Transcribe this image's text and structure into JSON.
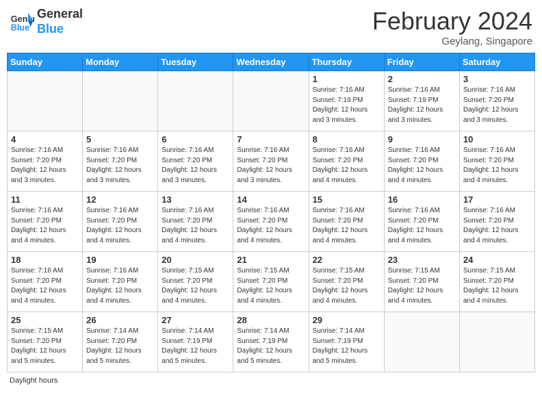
{
  "header": {
    "logo_general": "General",
    "logo_blue": "Blue",
    "month_year": "February 2024",
    "location": "Geylang, Singapore"
  },
  "days_of_week": [
    "Sunday",
    "Monday",
    "Tuesday",
    "Wednesday",
    "Thursday",
    "Friday",
    "Saturday"
  ],
  "weeks": [
    [
      {
        "day": "",
        "empty": true
      },
      {
        "day": "",
        "empty": true
      },
      {
        "day": "",
        "empty": true
      },
      {
        "day": "",
        "empty": true
      },
      {
        "day": "1",
        "sunrise": "7:16 AM",
        "sunset": "7:19 PM",
        "daylight": "12 hours and 3 minutes."
      },
      {
        "day": "2",
        "sunrise": "7:16 AM",
        "sunset": "7:19 PM",
        "daylight": "12 hours and 3 minutes."
      },
      {
        "day": "3",
        "sunrise": "7:16 AM",
        "sunset": "7:20 PM",
        "daylight": "12 hours and 3 minutes."
      }
    ],
    [
      {
        "day": "4",
        "sunrise": "7:16 AM",
        "sunset": "7:20 PM",
        "daylight": "12 hours and 3 minutes."
      },
      {
        "day": "5",
        "sunrise": "7:16 AM",
        "sunset": "7:20 PM",
        "daylight": "12 hours and 3 minutes."
      },
      {
        "day": "6",
        "sunrise": "7:16 AM",
        "sunset": "7:20 PM",
        "daylight": "12 hours and 3 minutes."
      },
      {
        "day": "7",
        "sunrise": "7:16 AM",
        "sunset": "7:20 PM",
        "daylight": "12 hours and 3 minutes."
      },
      {
        "day": "8",
        "sunrise": "7:16 AM",
        "sunset": "7:20 PM",
        "daylight": "12 hours and 4 minutes."
      },
      {
        "day": "9",
        "sunrise": "7:16 AM",
        "sunset": "7:20 PM",
        "daylight": "12 hours and 4 minutes."
      },
      {
        "day": "10",
        "sunrise": "7:16 AM",
        "sunset": "7:20 PM",
        "daylight": "12 hours and 4 minutes."
      }
    ],
    [
      {
        "day": "11",
        "sunrise": "7:16 AM",
        "sunset": "7:20 PM",
        "daylight": "12 hours and 4 minutes."
      },
      {
        "day": "12",
        "sunrise": "7:16 AM",
        "sunset": "7:20 PM",
        "daylight": "12 hours and 4 minutes."
      },
      {
        "day": "13",
        "sunrise": "7:16 AM",
        "sunset": "7:20 PM",
        "daylight": "12 hours and 4 minutes."
      },
      {
        "day": "14",
        "sunrise": "7:16 AM",
        "sunset": "7:20 PM",
        "daylight": "12 hours and 4 minutes."
      },
      {
        "day": "15",
        "sunrise": "7:16 AM",
        "sunset": "7:20 PM",
        "daylight": "12 hours and 4 minutes."
      },
      {
        "day": "16",
        "sunrise": "7:16 AM",
        "sunset": "7:20 PM",
        "daylight": "12 hours and 4 minutes."
      },
      {
        "day": "17",
        "sunrise": "7:16 AM",
        "sunset": "7:20 PM",
        "daylight": "12 hours and 4 minutes."
      }
    ],
    [
      {
        "day": "18",
        "sunrise": "7:16 AM",
        "sunset": "7:20 PM",
        "daylight": "12 hours and 4 minutes."
      },
      {
        "day": "19",
        "sunrise": "7:16 AM",
        "sunset": "7:20 PM",
        "daylight": "12 hours and 4 minutes."
      },
      {
        "day": "20",
        "sunrise": "7:15 AM",
        "sunset": "7:20 PM",
        "daylight": "12 hours and 4 minutes."
      },
      {
        "day": "21",
        "sunrise": "7:15 AM",
        "sunset": "7:20 PM",
        "daylight": "12 hours and 4 minutes."
      },
      {
        "day": "22",
        "sunrise": "7:15 AM",
        "sunset": "7:20 PM",
        "daylight": "12 hours and 4 minutes."
      },
      {
        "day": "23",
        "sunrise": "7:15 AM",
        "sunset": "7:20 PM",
        "daylight": "12 hours and 4 minutes."
      },
      {
        "day": "24",
        "sunrise": "7:15 AM",
        "sunset": "7:20 PM",
        "daylight": "12 hours and 4 minutes."
      }
    ],
    [
      {
        "day": "25",
        "sunrise": "7:15 AM",
        "sunset": "7:20 PM",
        "daylight": "12 hours and 5 minutes."
      },
      {
        "day": "26",
        "sunrise": "7:14 AM",
        "sunset": "7:20 PM",
        "daylight": "12 hours and 5 minutes."
      },
      {
        "day": "27",
        "sunrise": "7:14 AM",
        "sunset": "7:19 PM",
        "daylight": "12 hours and 5 minutes."
      },
      {
        "day": "28",
        "sunrise": "7:14 AM",
        "sunset": "7:19 PM",
        "daylight": "12 hours and 5 minutes."
      },
      {
        "day": "29",
        "sunrise": "7:14 AM",
        "sunset": "7:19 PM",
        "daylight": "12 hours and 5 minutes."
      },
      {
        "day": "",
        "empty": true
      },
      {
        "day": "",
        "empty": true
      }
    ]
  ],
  "footer": {
    "daylight_label": "Daylight hours"
  }
}
